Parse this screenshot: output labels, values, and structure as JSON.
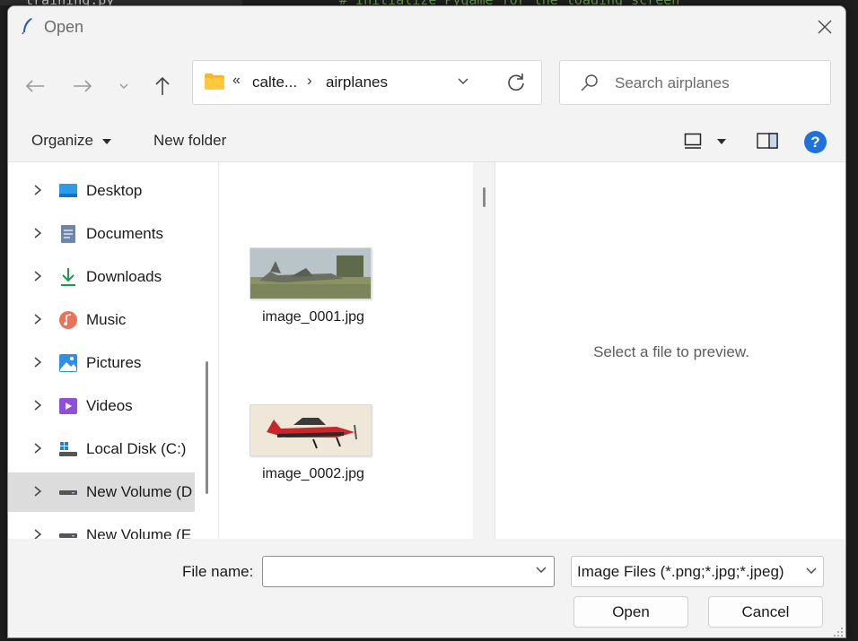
{
  "background": {
    "editor_lines": [
      {
        "text": "training.py",
        "color": "#cccccc"
      },
      {
        "text": "# Initialize Pygame for the loading screen",
        "color": "#6a9955"
      }
    ]
  },
  "dialog": {
    "title": "Open",
    "close_label": "✕"
  },
  "navigation": {
    "address": {
      "overflow": "«",
      "segment1": "calte...",
      "separator": "›",
      "segment2": "airplanes"
    },
    "search_placeholder": "Search airplanes"
  },
  "toolbar": {
    "organize": "Organize",
    "new_folder": "New folder",
    "help": "?"
  },
  "sidebar": {
    "items": [
      {
        "label": "Desktop",
        "icon": "desktop-icon",
        "selected": false
      },
      {
        "label": "Documents",
        "icon": "documents-icon",
        "selected": false
      },
      {
        "label": "Downloads",
        "icon": "downloads-icon",
        "selected": false
      },
      {
        "label": "Music",
        "icon": "music-icon",
        "selected": false
      },
      {
        "label": "Pictures",
        "icon": "pictures-icon",
        "selected": false
      },
      {
        "label": "Videos",
        "icon": "videos-icon",
        "selected": false
      },
      {
        "label": "Local Disk (C:)",
        "icon": "local-disk-icon",
        "selected": false
      },
      {
        "label": "New Volume (D",
        "icon": "drive-icon",
        "selected": true
      },
      {
        "label": "New Volume (E",
        "icon": "drive-icon",
        "selected": false
      }
    ]
  },
  "files": [
    {
      "name": "image_0001.jpg"
    },
    {
      "name": "image_0002.jpg"
    }
  ],
  "preview": {
    "message": "Select a file to preview."
  },
  "bottom": {
    "file_name_label": "File name:",
    "file_name_value": "",
    "filter_value": "Image Files (*.png;*.jpg;*.jpeg)",
    "open_label": "Open",
    "cancel_label": "Cancel"
  },
  "colors": {
    "accent": "#1e72d8",
    "folder": "#f4b731",
    "selected_row": "#dcdcdc"
  }
}
